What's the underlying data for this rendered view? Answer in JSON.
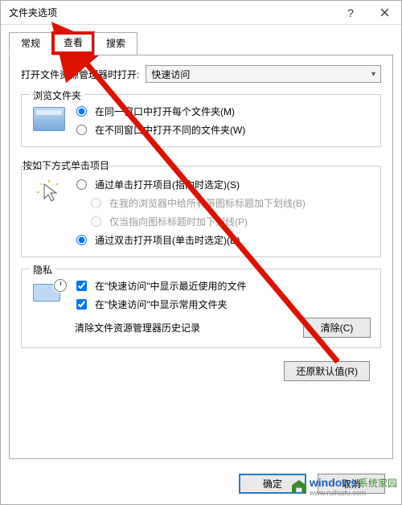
{
  "title": "文件夹选项",
  "tabs": {
    "general": "常规",
    "view": "查看",
    "search": "搜索"
  },
  "open_with_label": "打开文件资源管理器时打开:",
  "open_with_value": "快速访问",
  "browse": {
    "legend": "浏览文件夹",
    "opt_same": "在同一窗口中打开每个文件夹(M)",
    "opt_new": "在不同窗口中打开不同的文件夹(W)"
  },
  "click": {
    "legend": "按如下方式单击项目",
    "opt_single": "通过单击打开项目(指向时选定)(S)",
    "opt_single_a": "在我的浏览器中给所有带图标标题加下划线(B)",
    "opt_single_b": "仅当指向图标标题时加下划线(P)",
    "opt_double": "通过双击打开项目(单击时选定)(D)"
  },
  "privacy": {
    "legend": "隐私",
    "chk_recent": "在\"快速访问\"中显示最近使用的文件",
    "chk_freq": "在\"快速访问\"中显示常用文件夹",
    "clear_label": "清除文件资源管理器历史记录",
    "clear_btn": "清除(C)"
  },
  "restore_defaults": "还原默认值(R)",
  "ok": "确定",
  "cancel": "取消",
  "watermark": {
    "brand": "windows",
    "suffix": "系统家园",
    "url": "www.ruihaifu.com"
  }
}
